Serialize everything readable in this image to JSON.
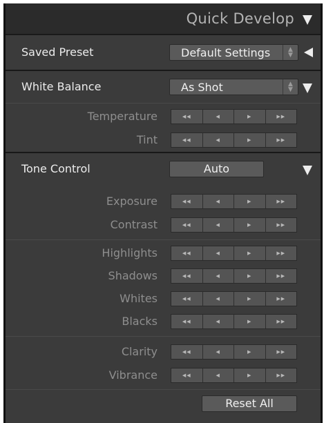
{
  "panel": {
    "title": "Quick Develop",
    "collapse_icon": "triangle-down-icon"
  },
  "saved_preset": {
    "label": "Saved Preset",
    "value": "Default Settings",
    "toggle_icon": "triangle-left-icon"
  },
  "white_balance": {
    "label": "White Balance",
    "value": "As Shot",
    "toggle_icon": "triangle-down-icon",
    "rows": [
      {
        "label": "Temperature"
      },
      {
        "label": "Tint"
      }
    ]
  },
  "tone_control": {
    "label": "Tone Control",
    "auto_label": "Auto",
    "toggle_icon": "triangle-down-icon",
    "rows": [
      {
        "label": "Exposure"
      },
      {
        "label": "Contrast"
      },
      {
        "label": "Highlights"
      },
      {
        "label": "Shadows"
      },
      {
        "label": "Whites"
      },
      {
        "label": "Blacks"
      },
      {
        "label": "Clarity"
      },
      {
        "label": "Vibrance"
      }
    ]
  },
  "stepper_glyphs": {
    "large_down": "◀◀",
    "small_down": "◀",
    "small_up": "▶",
    "large_up": "▶▶"
  },
  "reset_all_label": "Reset All"
}
